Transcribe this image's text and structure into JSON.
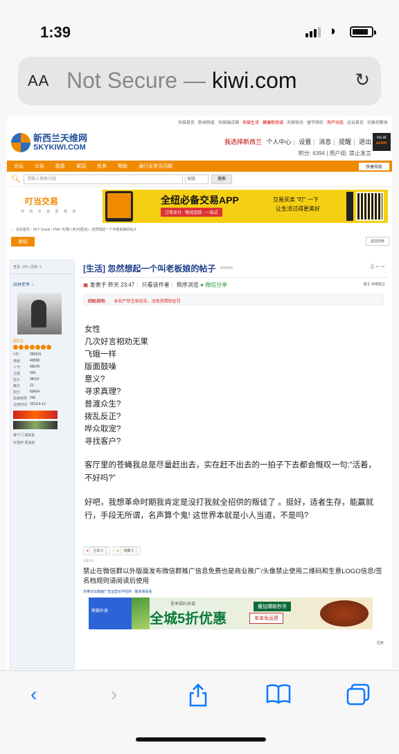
{
  "status": {
    "time": "1:39"
  },
  "address": {
    "aa": "AA",
    "not_secure": "Not Secure —",
    "domain": "kiwi.com"
  },
  "site": {
    "toplinks": [
      {
        "label": "天维首页"
      },
      {
        "label": "新闻频道"
      },
      {
        "label": "天维微店铺"
      },
      {
        "label": "天维生活",
        "red": true
      },
      {
        "label": "健康新商城",
        "red": true
      },
      {
        "label": "天维快讯"
      },
      {
        "label": "留学移民"
      },
      {
        "label": "房产动态",
        "red": true
      },
      {
        "label": "论坛首页"
      },
      {
        "label": "切换到繁体"
      }
    ],
    "logo_cn": "新西兰天维网",
    "logo_en": "SKYKIWI.COM",
    "usernav": {
      "pick": "我选择新西兰",
      "items": [
        "个人中心",
        "设置",
        "消息",
        "提醒",
        "退出"
      ],
      "points": "积分: 6394",
      "group": "用户组: 禁止发言",
      "avatar_line1": "ou ar",
      "avatar_line2": "acker"
    },
    "nav": [
      "论坛",
      "公告",
      "题意",
      "家园",
      "任务",
      "帮助",
      "通行证常见问题"
    ],
    "nav_quick": "快捷导航",
    "search": {
      "placeholder": "请输入搜索内容",
      "scope": "本版",
      "button": "搜索"
    },
    "banner": {
      "brand": "叮当交易",
      "slogan": "你 的 交 易 更 简 单",
      "headline": "全纽必备交易APP",
      "sub": "订单支付 · 物流追踪 · 一站式",
      "r1": "交易买卖 \"叮\" 一下",
      "r2": "让生活过得更美好"
    },
    "breadcrumb": "论坛首页  ›  SKY Social  ›  FML! 吐槽八卦(可匿名)  ›  忽然想起一个叫老板娘的帖子",
    "post_button": "发帖",
    "back_button": "返回列表",
    "left": {
      "stats": "查看: 196  |  回复: 3",
      "author": "旧林老爷",
      "rank": "副坛主",
      "rows": [
        {
          "k": "UID",
          "v": "369101"
        },
        {
          "k": "类级",
          "v": "40098"
        },
        {
          "k": "人气",
          "v": "49078"
        },
        {
          "k": "主题",
          "v": "943"
        },
        {
          "k": "帖子",
          "v": "38115"
        },
        {
          "k": "精华",
          "v": "21"
        },
        {
          "k": "积分",
          "v": "69424"
        },
        {
          "k": "阅读权限",
          "v": "250"
        },
        {
          "k": "注册时间",
          "v": "2013-4-12"
        }
      ],
      "links1": "串个门    加好友",
      "links2": "打招呼    发消息"
    },
    "post": {
      "title": "[生活] 忽然想起一个叫老板娘的帖子",
      "copy": "[复制链接]",
      "meta_prefix": "发表于 昨天 23:47",
      "meta_only_author": "只看该作者",
      "meta_reverse": "倒序浏览",
      "meta_wechat": "微信分享",
      "meta_right": "楼主  电梯直达",
      "notice_label": "回帖说明:",
      "notice_text": "本帖严禁互相攻击，违者视情取处罚",
      "lines": [
        "女性",
        "几次好言相劝无果",
        "飞蛾一样",
        "版面鼓噪",
        "意义?",
        "寻求真理?",
        "普渡众生?",
        "拨乱反正?",
        "哗众取宠?",
        "寻找客户?"
      ],
      "p1": "客厅里的苍蝇我总是尽量赶出去，实在赶不出去的一拍子下去都会慨叹一句:“活着，不好吗?”",
      "p2": "好吧，我想革命时期我肯定是没打我就全招供的叛徒了 。挺好，适者生存，能赢就行，手段无所谓，名声算个鬼! 这世界本就是小人当道，不是吗?",
      "like": "分享 0",
      "fav": "收藏 0",
      "sig_small": "回复本帖",
      "disclaimer": "禁止在微信群以外版面发布微信群推广信息免费也是商业推广/头像禁止使用二维码和生意LOGO信息/签名档规则请阅读后使用",
      "adlink": "天维论坛版面广告运营合作招商 · 联系我看看",
      "ad2_brand": "熊猫外卖",
      "ad2_small": "夏季福利来袭",
      "ad2_big": "全城5折优惠",
      "ad2_tag1": "叠加爆款秒杀",
      "ad2_tag2": "单单免运费",
      "reply": "回复"
    }
  },
  "toolbar": {
    "back": "back-icon",
    "forward": "forward-icon",
    "share": "share-icon",
    "bookmarks": "book-icon",
    "tabs": "tabs-icon"
  },
  "colors": {
    "accent": "#f08a00",
    "link": "#1f4e9a",
    "ios_blue": "#0a78ff"
  }
}
